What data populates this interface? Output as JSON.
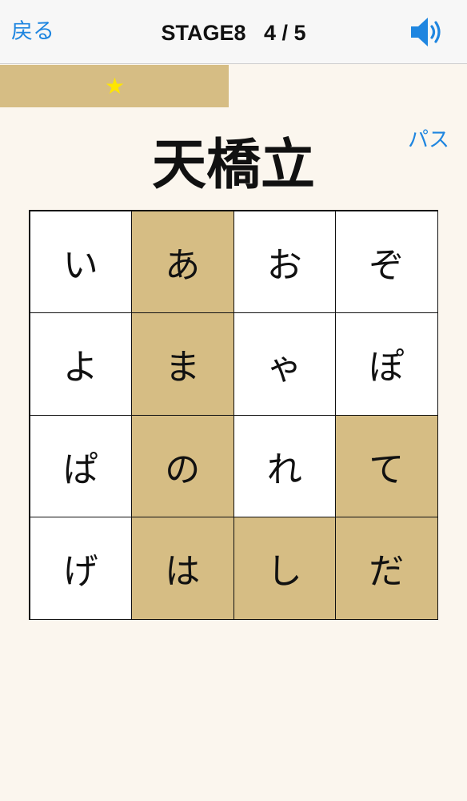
{
  "header": {
    "back_label": "戻る",
    "title": "STAGE8   4 / 5",
    "sound_icon": "speaker-volume-icon"
  },
  "progress": {
    "fraction": 0.49,
    "stars": "★",
    "bar_color": "#d6bd84",
    "star_color": "#ffe600"
  },
  "pass_label": "パス",
  "question": "天橋立",
  "colors": {
    "accent": "#1f86e0",
    "selected_cell": "#d6bd84",
    "background": "#fbf6ee"
  },
  "grid": {
    "cells": [
      {
        "char": "い",
        "selected": false
      },
      {
        "char": "あ",
        "selected": true
      },
      {
        "char": "お",
        "selected": false
      },
      {
        "char": "ぞ",
        "selected": false
      },
      {
        "char": "よ",
        "selected": false
      },
      {
        "char": "ま",
        "selected": true
      },
      {
        "char": "ゃ",
        "selected": false
      },
      {
        "char": "ぽ",
        "selected": false
      },
      {
        "char": "ぱ",
        "selected": false
      },
      {
        "char": "の",
        "selected": true
      },
      {
        "char": "れ",
        "selected": false
      },
      {
        "char": "て",
        "selected": true
      },
      {
        "char": "げ",
        "selected": false
      },
      {
        "char": "は",
        "selected": true
      },
      {
        "char": "し",
        "selected": true
      },
      {
        "char": "だ",
        "selected": true
      }
    ]
  }
}
